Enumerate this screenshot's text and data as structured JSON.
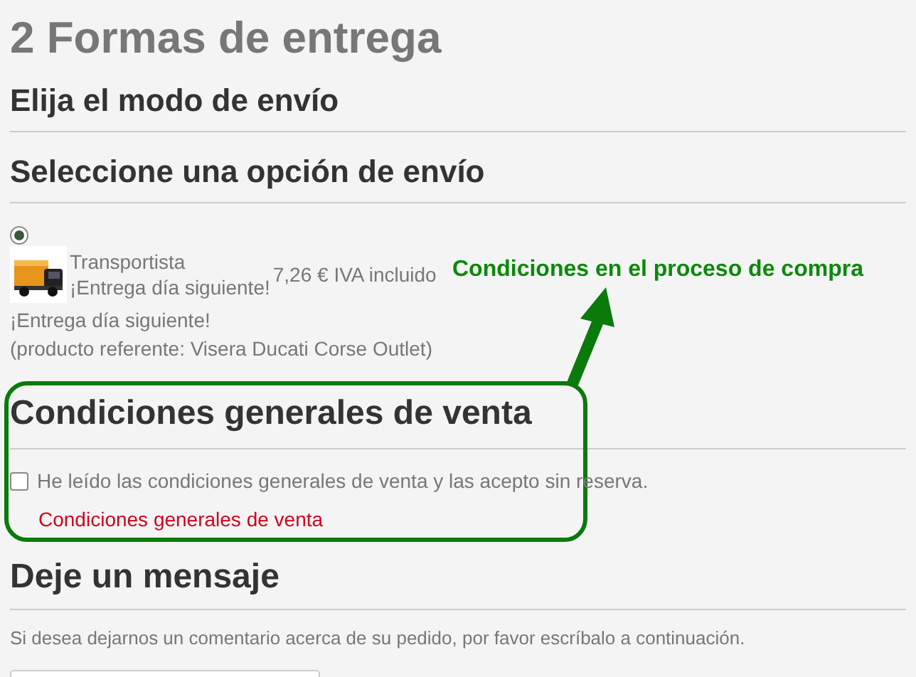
{
  "page_title": "2 Formas de entrega",
  "delivery_mode_heading": "Elija el modo de envío",
  "shipping_option_heading": "Seleccione una opción de envío",
  "carrier": {
    "selected": true,
    "name": "Transportista",
    "delay": "¡Entrega día siguiente!",
    "price": "7,26 € IVA incluido",
    "note": "¡Entrega día siguiente!",
    "reference": "(producto referente: Visera Ducati Corse Outlet)"
  },
  "terms": {
    "heading": "Condiciones generales de venta",
    "checkbox_label": "He leído las condiciones generales de venta y las acepto sin reserva.",
    "checked": false,
    "link": "Condiciones generales de venta"
  },
  "message": {
    "heading": "Deje un mensaje",
    "hint": "Si desea dejarnos un comentario acerca de su pedido, por favor escríbalo a continuación."
  },
  "annotation": {
    "label": "Condiciones en el proceso de compra"
  }
}
